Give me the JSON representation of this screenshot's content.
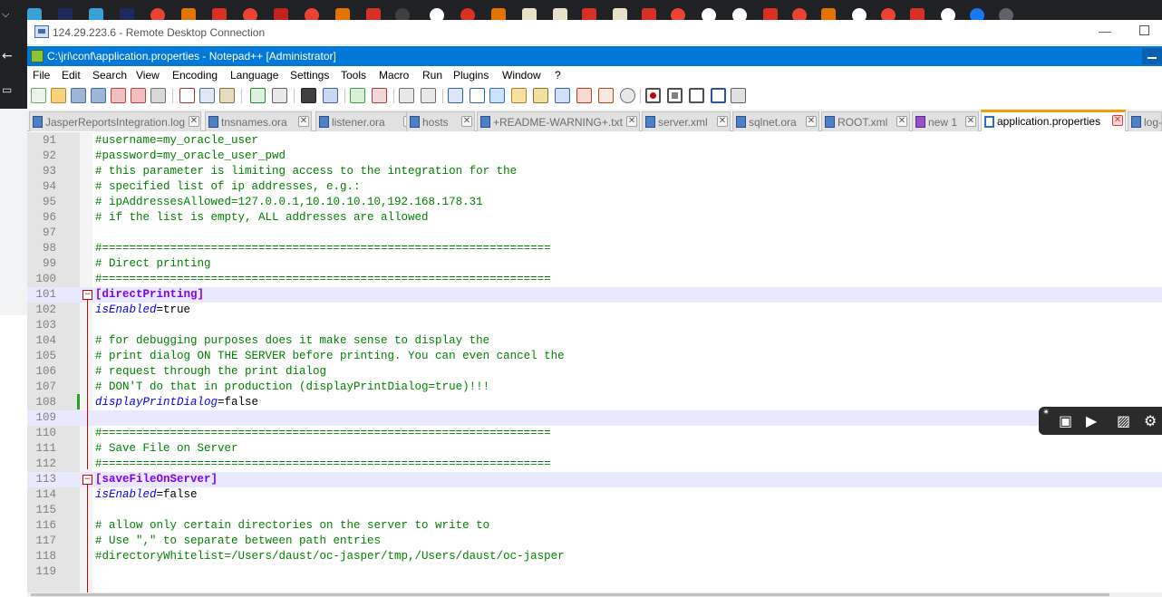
{
  "rdp": {
    "title": "124.29.223.6 - Remote Desktop Connection"
  },
  "npp": {
    "title": "C:\\jri\\conf\\application.properties - Notepad++ [Administrator]"
  },
  "menu": [
    "File",
    "Edit",
    "Search",
    "View",
    "Encoding",
    "Language",
    "Settings",
    "Tools",
    "Macro",
    "Run",
    "Plugins",
    "Window",
    "?"
  ],
  "tabs": [
    {
      "label": "JasperReportsIntegration.log",
      "active": false
    },
    {
      "label": "tnsnames.ora",
      "active": false
    },
    {
      "label": "listener.ora",
      "active": false
    },
    {
      "label": "hosts",
      "active": false
    },
    {
      "label": "+README-WARNING+.txt",
      "active": false
    },
    {
      "label": "server.xml",
      "active": false
    },
    {
      "label": "sqlnet.ora",
      "active": false
    },
    {
      "label": "ROOT.xml",
      "active": false
    },
    {
      "label": "new 1",
      "active": false
    },
    {
      "label": "application.properties",
      "active": true
    },
    {
      "label": "log-",
      "active": false
    }
  ],
  "editor": {
    "lines": [
      {
        "n": "91",
        "t": "#username=my_oracle_user"
      },
      {
        "n": "92",
        "t": "#password=my_oracle_user_pwd"
      },
      {
        "n": "93",
        "t": "# this parameter is limiting access to the integration for the"
      },
      {
        "n": "94",
        "t": "# specified list of ip addresses, e.g.:"
      },
      {
        "n": "95",
        "t": "# ipAddressesAllowed=127.0.0.1,10.10.10.10,192.168.178.31"
      },
      {
        "n": "96",
        "t": "# if the list is empty, ALL addresses are allowed"
      },
      {
        "n": "97",
        "t": ""
      },
      {
        "n": "98",
        "t": "#=================================================================="
      },
      {
        "n": "99",
        "t": "# Direct printing"
      },
      {
        "n": "100",
        "t": "#=================================================================="
      },
      {
        "n": "101",
        "t": "[directPrinting]"
      },
      {
        "n": "102",
        "t": "isEnabled=true"
      },
      {
        "n": "103",
        "t": ""
      },
      {
        "n": "104",
        "t": "# for debugging purposes does it make sense to display the"
      },
      {
        "n": "105",
        "t": "# print dialog ON THE SERVER before printing. You can even cancel the"
      },
      {
        "n": "106",
        "t": "# request through the print dialog"
      },
      {
        "n": "107",
        "t": "# DON'T do that in production (displayPrintDialog=true)!!!"
      },
      {
        "n": "108",
        "t": "displayPrintDialog=false"
      },
      {
        "n": "109",
        "t": ""
      },
      {
        "n": "110",
        "t": "#=================================================================="
      },
      {
        "n": "111",
        "t": "# Save File on Server"
      },
      {
        "n": "112",
        "t": "#=================================================================="
      },
      {
        "n": "113",
        "t": "[saveFileOnServer]"
      },
      {
        "n": "114",
        "t": "isEnabled=false"
      },
      {
        "n": "115",
        "t": ""
      },
      {
        "n": "116",
        "t": "# allow only certain directories on the server to write to"
      },
      {
        "n": "117",
        "t": "# Use \",\" to separate between path entries"
      },
      {
        "n": "118",
        "t": "#directoryWhitelist=/Users/daust/oc-jasper/tmp,/Users/daust/oc-jasper"
      },
      {
        "n": "119",
        "t": ""
      }
    ]
  },
  "colors": {
    "comment": "#008000",
    "section": "#8000ff",
    "key": "#0000ff",
    "titlebar": "#0078d7",
    "active_tab_accent": "#f0a000",
    "current_line": "#e8e8ff"
  },
  "icons": {
    "capture_toolbar": [
      "pin-icon",
      "camera-icon",
      "video-icon",
      "image-icon",
      "gear-icon"
    ]
  }
}
